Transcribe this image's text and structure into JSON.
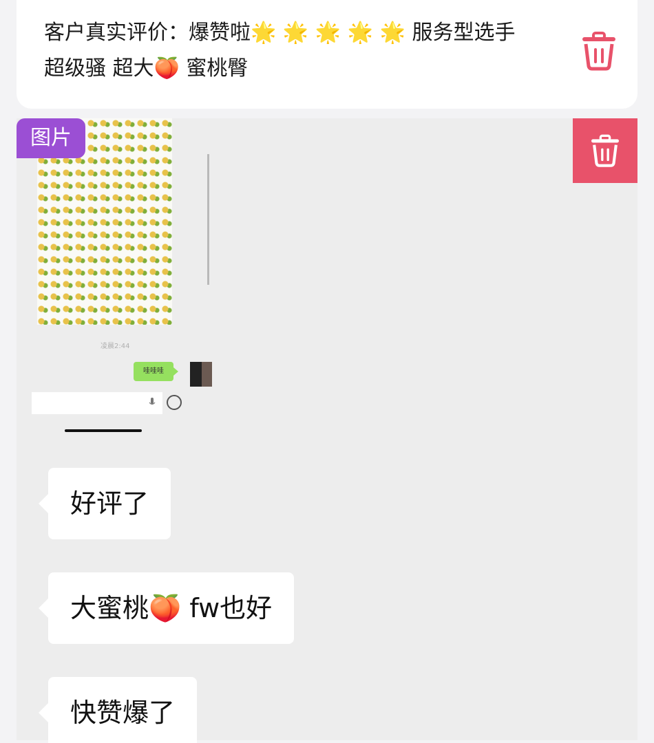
{
  "review": {
    "text": "客户真实评价：爆赞啦🌟 🌟 🌟 🌟 🌟 服务型选手\n超级骚 超大🍑 蜜桃臀"
  },
  "badge": {
    "label": "图片"
  },
  "embed": {
    "time": "凌晨2:44",
    "green_bubble": "哇哇哇"
  },
  "messages": [
    {
      "text": "好评了"
    },
    {
      "text": "大蜜桃🍑 fw也好"
    },
    {
      "text": "快赞爆了"
    }
  ],
  "icons": {
    "delete": "trash-icon",
    "mic": "mic-icon",
    "emoji": "smile-icon"
  },
  "colors": {
    "delete_outline": "#e8526a",
    "delete_fill": "#e8526a",
    "badge": "#9b4fd4",
    "green_bubble": "#95e05f"
  }
}
